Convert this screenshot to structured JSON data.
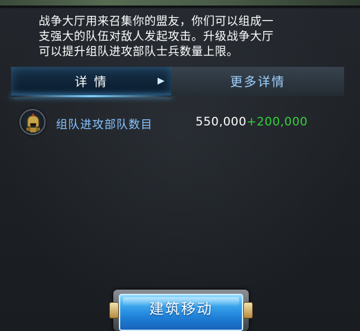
{
  "description": {
    "line1": "战争大厅用来召集你的盟友，你们可以组成一",
    "line2": "支强大的队伍对敌人发起攻击。升级战争大厅",
    "line3": "可以提升组队进攻部队士兵数量上限。"
  },
  "tabs": {
    "detail": "详 情",
    "more_detail": "更多详情",
    "active": "detail"
  },
  "stat": {
    "label": "组队进攻部队数目",
    "base_value": "550,000",
    "bonus_value": "+200,000",
    "icon": "warrior-helmet-icon"
  },
  "actions": {
    "move_building": "建筑移动"
  },
  "colors": {
    "accent_blue": "#86c2ff",
    "bonus_green": "#36d03a",
    "button_blue": "#1f7fd6"
  }
}
